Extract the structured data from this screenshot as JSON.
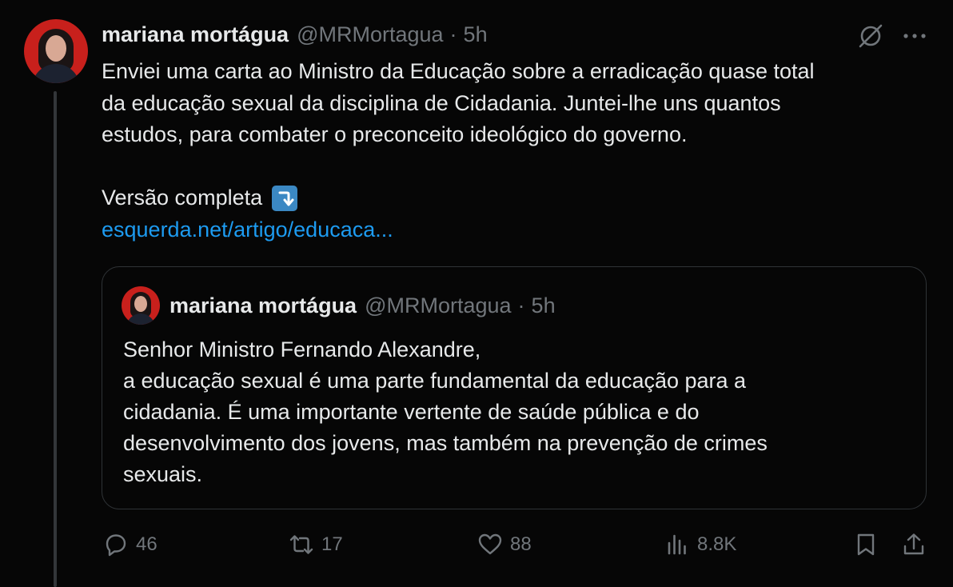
{
  "author": {
    "name": "mariana mortágua",
    "handle": "@MRMortagua",
    "separator": "·",
    "time": "5h"
  },
  "tweet": {
    "lines": [
      "Enviei uma carta ao Ministro da Educação sobre a erradicação quase total",
      "da educação sexual da disciplina de Cidadania. Juntei-lhe uns quantos",
      "estudos, para combater o preconceito ideológico do governo."
    ],
    "versao_label": "Versão completa",
    "link_text": "esquerda.net/artigo/educaca..."
  },
  "quote": {
    "name": "mariana mortágua",
    "handle": "@MRMortagua",
    "separator": "·",
    "time": "5h",
    "lines": [
      "Senhor Ministro Fernando Alexandre,",
      "a educação sexual é uma parte fundamental da educação para a",
      "cidadania. É uma importante vertente de saúde pública e do",
      "desenvolvimento dos jovens, mas também na prevenção de crimes",
      "sexuais."
    ]
  },
  "actions": {
    "replies": "46",
    "retweets": "17",
    "likes": "88",
    "views": "8.8K"
  },
  "colors": {
    "background": "#060606",
    "text": "#e7e9ea",
    "muted": "#71767b",
    "link": "#1d9bf0",
    "avatar_bg": "#c8201c"
  }
}
